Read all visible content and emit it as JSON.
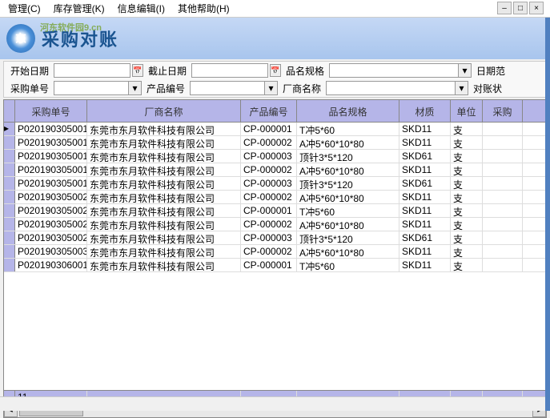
{
  "menu": {
    "m1": "管理(C)",
    "m2": "库存管理(K)",
    "m3": "信息编辑(I)",
    "m4": "其他帮助(H)"
  },
  "watermark": "河东软件园9.cn",
  "title": "采购对账",
  "filters": {
    "start_label": "开始日期",
    "end_label": "截止日期",
    "spec_label": "品名规格",
    "daterange_label": "日期范",
    "order_label": "采购单号",
    "prodcode_label": "产品编号",
    "vendor_label": "厂商名称",
    "recon_label": "对账状"
  },
  "headers": {
    "c1": "采购单号",
    "c2": "厂商名称",
    "c3": "产品编号",
    "c4": "品名规格",
    "c5": "材质",
    "c6": "单位",
    "c7": "采购"
  },
  "rows": [
    {
      "c1": "P020190305001",
      "c2": "东莞市东月软件科技有限公司",
      "c3": "CP-000001",
      "c4": "T冲5*60",
      "c5": "SKD11",
      "c6": "支"
    },
    {
      "c1": "P020190305001",
      "c2": "东莞市东月软件科技有限公司",
      "c3": "CP-000002",
      "c4": "A冲5*60*10*80",
      "c5": "SKD11",
      "c6": "支"
    },
    {
      "c1": "P020190305001",
      "c2": "东莞市东月软件科技有限公司",
      "c3": "CP-000003",
      "c4": "顶针3*5*120",
      "c5": "SKD61",
      "c6": "支"
    },
    {
      "c1": "P020190305001",
      "c2": "东莞市东月软件科技有限公司",
      "c3": "CP-000002",
      "c4": "A冲5*60*10*80",
      "c5": "SKD11",
      "c6": "支"
    },
    {
      "c1": "P020190305001",
      "c2": "东莞市东月软件科技有限公司",
      "c3": "CP-000003",
      "c4": "顶针3*5*120",
      "c5": "SKD61",
      "c6": "支"
    },
    {
      "c1": "P020190305002",
      "c2": "东莞市东月软件科技有限公司",
      "c3": "CP-000002",
      "c4": "A冲5*60*10*80",
      "c5": "SKD11",
      "c6": "支"
    },
    {
      "c1": "P020190305002",
      "c2": "东莞市东月软件科技有限公司",
      "c3": "CP-000001",
      "c4": "T冲5*60",
      "c5": "SKD11",
      "c6": "支"
    },
    {
      "c1": "P020190305002",
      "c2": "东莞市东月软件科技有限公司",
      "c3": "CP-000002",
      "c4": "A冲5*60*10*80",
      "c5": "SKD11",
      "c6": "支"
    },
    {
      "c1": "P020190305002",
      "c2": "东莞市东月软件科技有限公司",
      "c3": "CP-000003",
      "c4": "顶针3*5*120",
      "c5": "SKD61",
      "c6": "支"
    },
    {
      "c1": "P020190305003",
      "c2": "东莞市东月软件科技有限公司",
      "c3": "CP-000002",
      "c4": "A冲5*60*10*80",
      "c5": "SKD11",
      "c6": "支"
    },
    {
      "c1": "P020190306001",
      "c2": "东莞市东月软件科技有限公司",
      "c3": "CP-000001",
      "c4": "T冲5*60",
      "c5": "SKD11",
      "c6": "支"
    }
  ],
  "footer_count": "11",
  "status": ""
}
